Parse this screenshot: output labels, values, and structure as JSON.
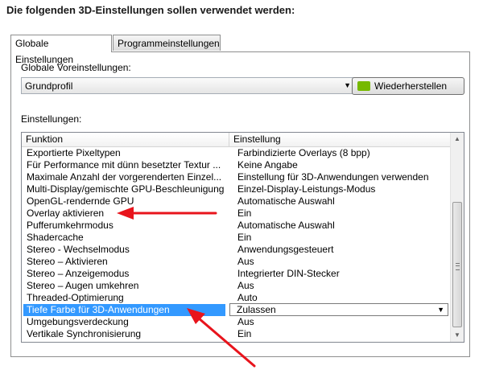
{
  "heading": "Die folgenden 3D-Einstellungen sollen verwendet werden:",
  "tabs": [
    {
      "label": "Globale Einstellungen",
      "active": true
    },
    {
      "label": "Programmeinstellungen",
      "active": false
    }
  ],
  "preset": {
    "label": "Globale Voreinstellungen:",
    "value": "Grundprofil",
    "restore_button": "Wiederherstellen"
  },
  "settings": {
    "label": "Einstellungen:",
    "columns": [
      "Funktion",
      "Einstellung"
    ],
    "rows": [
      {
        "f": "Exportierte Pixeltypen",
        "v": "Farbindizierte Overlays (8 bpp)"
      },
      {
        "f": "Für Performance mit dünn besetzter Textur ...",
        "v": "Keine Angabe"
      },
      {
        "f": "Maximale Anzahl der vorgerenderten Einzel...",
        "v": "Einstellung für 3D-Anwendungen verwenden"
      },
      {
        "f": "Multi-Display/gemischte GPU-Beschleunigung",
        "v": "Einzel-Display-Leistungs-Modus"
      },
      {
        "f": "OpenGL-rendernde GPU",
        "v": "Automatische Auswahl"
      },
      {
        "f": "Overlay aktivieren",
        "v": "Ein"
      },
      {
        "f": "Pufferumkehrmodus",
        "v": "Automatische Auswahl"
      },
      {
        "f": "Shadercache",
        "v": "Ein"
      },
      {
        "f": "Stereo - Wechselmodus",
        "v": "Anwendungsgesteuert"
      },
      {
        "f": "Stereo – Aktivieren",
        "v": "Aus"
      },
      {
        "f": "Stereo – Anzeigemodus",
        "v": "Integrierter DIN-Stecker"
      },
      {
        "f": "Stereo – Augen umkehren",
        "v": "Aus"
      },
      {
        "f": "Threaded-Optimierung",
        "v": "Auto"
      },
      {
        "f": "Tiefe Farbe für 3D-Anwendungen",
        "v": "Zulassen",
        "selected": true
      },
      {
        "f": "Umgebungsverdeckung",
        "v": "Aus"
      },
      {
        "f": "Vertikale Synchronisierung",
        "v": "Ein"
      }
    ]
  },
  "colors": {
    "selection": "#3399ff",
    "annotation_arrow": "#e8141c",
    "nvidia_green": "#76b900"
  }
}
